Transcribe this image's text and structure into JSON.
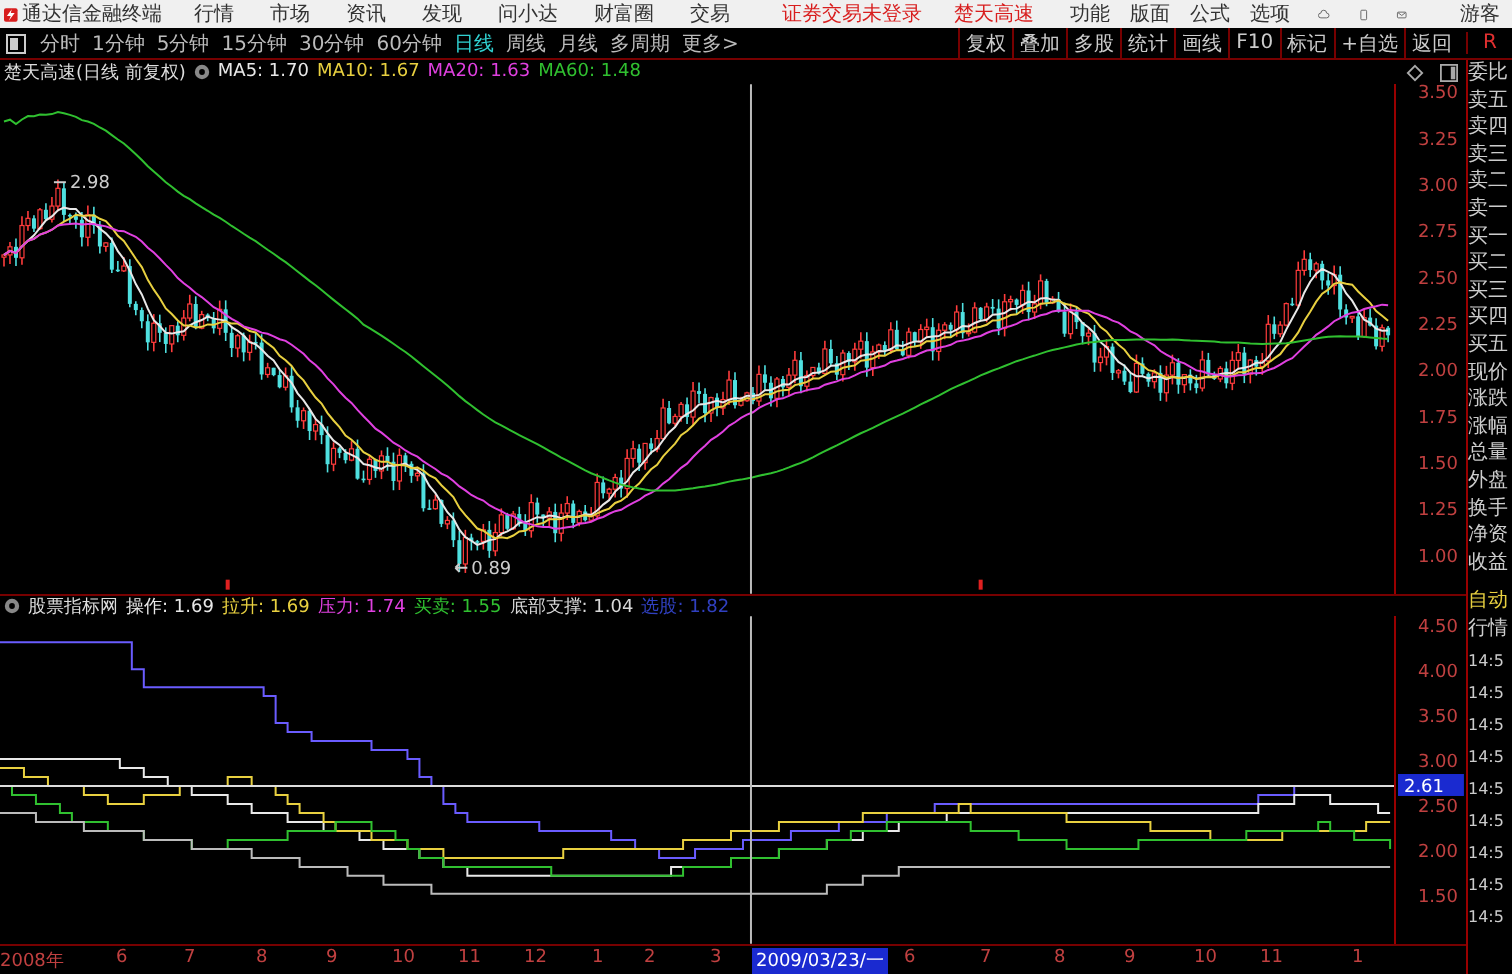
{
  "title_bar": {
    "app_name": "通达信金融终端",
    "menus": [
      "行情",
      "市场",
      "资讯",
      "发现",
      "问小达",
      "财富圈",
      "交易"
    ],
    "login_status": "证券交易未登录",
    "stock_name": "楚天高速",
    "right_menus": [
      "功能",
      "版面",
      "公式",
      "选项"
    ],
    "user": "游客"
  },
  "toolbar": {
    "periods": [
      {
        "label": "分时",
        "selected": false
      },
      {
        "label": "1分钟",
        "selected": false
      },
      {
        "label": "5分钟",
        "selected": false
      },
      {
        "label": "15分钟",
        "selected": false
      },
      {
        "label": "30分钟",
        "selected": false
      },
      {
        "label": "60分钟",
        "selected": false
      },
      {
        "label": "日线",
        "selected": true
      },
      {
        "label": "周线",
        "selected": false
      },
      {
        "label": "月线",
        "selected": false
      },
      {
        "label": "多周期",
        "selected": false
      },
      {
        "label": "更多>",
        "selected": false
      }
    ],
    "buttons": [
      "复权",
      "叠加",
      "多股",
      "统计",
      "画线",
      "F10",
      "标记",
      "+自选",
      "返回"
    ],
    "corner_label": "R"
  },
  "main_chart": {
    "title": "楚天高速(日线 前复权)",
    "ma": [
      {
        "label": "MA5: 1.70",
        "color": "#e8e8e8"
      },
      {
        "label": "MA10: 1.67",
        "color": "#e8d040"
      },
      {
        "label": "MA20: 1.63",
        "color": "#e040e0"
      },
      {
        "label": "MA60: 1.48",
        "color": "#30c030"
      }
    ],
    "yticks": [
      "3.50",
      "3.25",
      "3.00",
      "2.75",
      "2.50",
      "2.25",
      "2.00",
      "1.75",
      "1.50",
      "1.25",
      "1.00"
    ],
    "high_label": "2.98",
    "low_label": "0.89"
  },
  "indicator": {
    "name": "股票指标网",
    "values": [
      {
        "label": "操作: 1.69",
        "color": "#e8e8e8"
      },
      {
        "label": "拉升: 1.69",
        "color": "#e8d040"
      },
      {
        "label": "压力: 1.74",
        "color": "#e040e0"
      },
      {
        "label": "买卖: 1.55",
        "color": "#30c030"
      },
      {
        "label": "底部支撑: 1.04",
        "color": "#d8d8d8"
      },
      {
        "label": "选股: 1.82",
        "color": "#3040c0"
      }
    ],
    "yticks": [
      "4.50",
      "4.00",
      "3.50",
      "3.00",
      "2.50",
      "2.00",
      "1.50"
    ],
    "cursor_value": "2.61"
  },
  "date_axis": {
    "labels": [
      "2008年",
      "6",
      "7",
      "8",
      "9",
      "10",
      "11",
      "12",
      "1",
      "2",
      "3",
      "6",
      "7",
      "8",
      "9",
      "10",
      "11",
      "1"
    ],
    "cursor_date": "2009/03/23/一"
  },
  "quote_panel": {
    "labels": [
      "委比",
      "卖五",
      "卖四",
      "卖三",
      "卖二",
      "卖一",
      "买一",
      "买二",
      "买三",
      "买四",
      "买五",
      "现价",
      "涨跌",
      "涨幅",
      "总量",
      "外盘",
      "换手",
      "净资",
      "收益"
    ],
    "auto_label": "自动",
    "quote_label": "行情",
    "times": [
      "14:5",
      "14:5",
      "14:5",
      "14:5",
      "14:5",
      "14:5",
      "14:5",
      "14:5",
      "14:5"
    ]
  }
}
